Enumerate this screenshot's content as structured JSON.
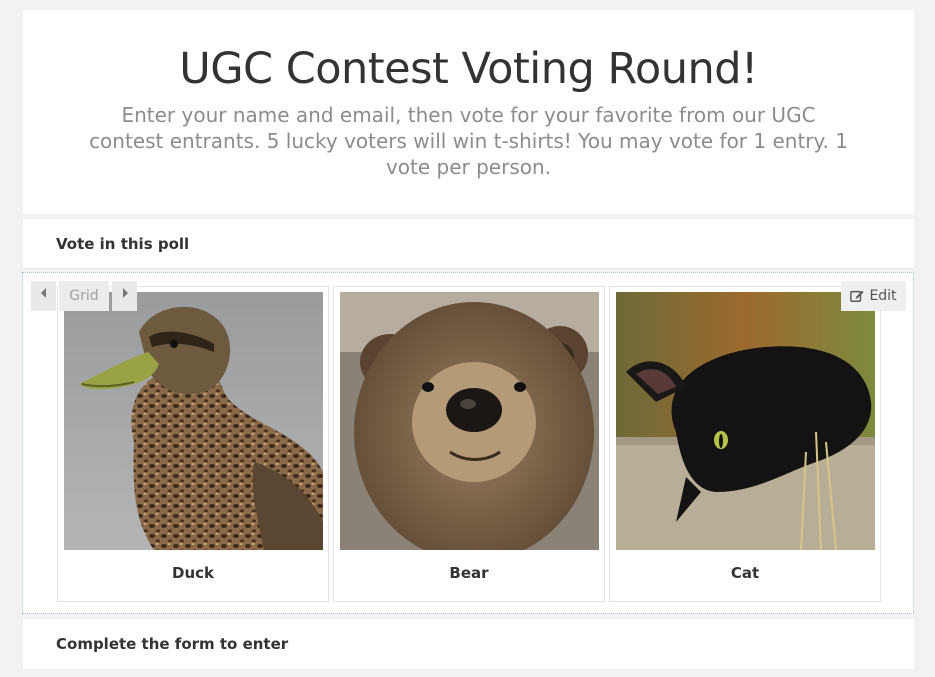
{
  "header": {
    "title": "UGC Contest Voting Round!",
    "subtitle": "Enter your name and email, then vote for your favorite from our UGC contest entrants. 5 lucky voters will win t-shirts! You may vote for 1 entry. 1 vote per person."
  },
  "poll": {
    "heading": "Vote in this poll",
    "toolbar": {
      "prev_icon": "caret-left-icon",
      "layout_label": "Grid",
      "next_icon": "caret-right-icon"
    },
    "edit_label": "Edit",
    "edit_icon": "edit-icon",
    "entries": [
      {
        "label": "Duck",
        "image": "duck-photo"
      },
      {
        "label": "Bear",
        "image": "bear-photo"
      },
      {
        "label": "Cat",
        "image": "cat-photo"
      }
    ]
  },
  "form": {
    "heading": "Complete the form to enter"
  },
  "colors": {
    "page_bg": "#f2f2f2",
    "title": "#333333",
    "subtitle": "#8c8c8c",
    "poll_border": "#9fc8da"
  }
}
